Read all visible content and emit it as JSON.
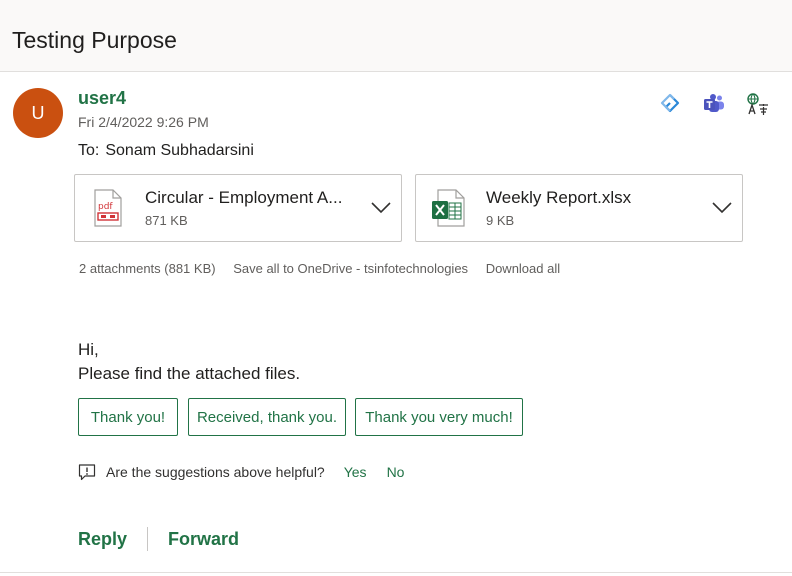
{
  "subject": "Testing Purpose",
  "sender": {
    "initial": "U",
    "name": "user4",
    "datetime": "Fri 2/4/2022 9:26 PM",
    "to_label": "To:",
    "to_name": "Sonam Subhadarsini",
    "avatar_color": "#ca5010"
  },
  "header_icons": [
    "loop-icon",
    "teams-icon",
    "translate-icon"
  ],
  "attachments": [
    {
      "name": "Circular - Employment A...",
      "size": "871 KB",
      "icon": "pdf-file-icon"
    },
    {
      "name": "Weekly Report.xlsx",
      "size": "9 KB",
      "icon": "excel-file-icon"
    }
  ],
  "attachment_actions": {
    "summary": "2 attachments (881 KB)",
    "save_all": "Save all to OneDrive - tsinfotechnologies",
    "download_all": "Download all"
  },
  "body": {
    "line1": "Hi,",
    "line2": "Please find the attached files."
  },
  "suggested_replies": [
    "Thank you!",
    "Received, thank you.",
    "Thank you very much!"
  ],
  "feedback": {
    "question": "Are the suggestions above helpful?",
    "yes": "Yes",
    "no": "No"
  },
  "actions": {
    "reply": "Reply",
    "forward": "Forward"
  },
  "colors": {
    "accent": "#217346",
    "subject_bar": "#faf9f8"
  }
}
